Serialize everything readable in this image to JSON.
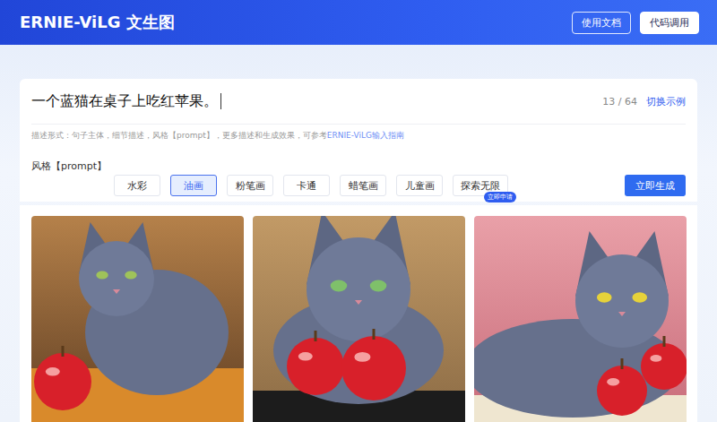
{
  "header": {
    "title": "ERNIE-ViLG 文生图",
    "buttons": [
      {
        "label": "使用文档",
        "kind": "outline"
      },
      {
        "label": "代码调用",
        "kind": "solid"
      }
    ]
  },
  "prompt": {
    "value": "一个蓝猫在桌子上吃红苹果。",
    "count": "13 / 64",
    "switch": "切换示例"
  },
  "hint": {
    "text": "描述形式：句子主体，细节描述，风格【prompt】，更多描述和生成效果，可参考",
    "link": "ERNIE-ViLG输入指南"
  },
  "style_label": "风格【prompt】",
  "styles": [
    {
      "label": "水彩",
      "selected": false
    },
    {
      "label": "油画",
      "selected": true
    },
    {
      "label": "粉笔画",
      "selected": false
    },
    {
      "label": "卡通",
      "selected": false
    },
    {
      "label": "蜡笔画",
      "selected": false
    },
    {
      "label": "儿童画",
      "selected": false
    },
    {
      "label": "探索无限",
      "selected": false,
      "badge": "立即申请"
    }
  ],
  "generate": "立即生成"
}
